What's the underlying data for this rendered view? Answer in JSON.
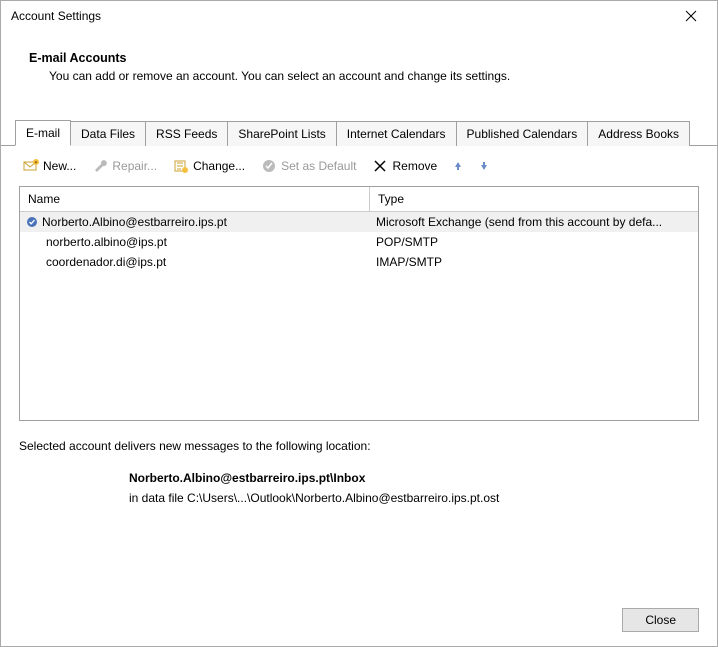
{
  "title": "Account Settings",
  "heading": {
    "title": "E-mail Accounts",
    "desc": "You can add or remove an account. You can select an account and change its settings."
  },
  "tabs": [
    {
      "label": "E-mail",
      "active": true
    },
    {
      "label": "Data Files"
    },
    {
      "label": "RSS Feeds"
    },
    {
      "label": "SharePoint Lists"
    },
    {
      "label": "Internet Calendars"
    },
    {
      "label": "Published Calendars"
    },
    {
      "label": "Address Books"
    }
  ],
  "toolbar": {
    "new": "New...",
    "repair": "Repair...",
    "change": "Change...",
    "setdefault": "Set as Default",
    "remove": "Remove"
  },
  "columns": {
    "name": "Name",
    "type": "Type"
  },
  "accounts": [
    {
      "name": "Norberto.Albino@estbarreiro.ips.pt",
      "type": "Microsoft Exchange (send from this account by defa...",
      "default": true,
      "selected": true
    },
    {
      "name": "norberto.albino@ips.pt",
      "type": "POP/SMTP",
      "default": false,
      "selected": false
    },
    {
      "name": "coordenador.di@ips.pt",
      "type": "IMAP/SMTP",
      "default": false,
      "selected": false
    }
  ],
  "delivery": {
    "label": "Selected account delivers new messages to the following location:",
    "path_main": "Norberto.Albino@estbarreiro.ips.pt\\Inbox",
    "path_sub": "in data file C:\\Users\\...\\Outlook\\Norberto.Albino@estbarreiro.ips.pt.ost"
  },
  "footer": {
    "close": "Close"
  }
}
